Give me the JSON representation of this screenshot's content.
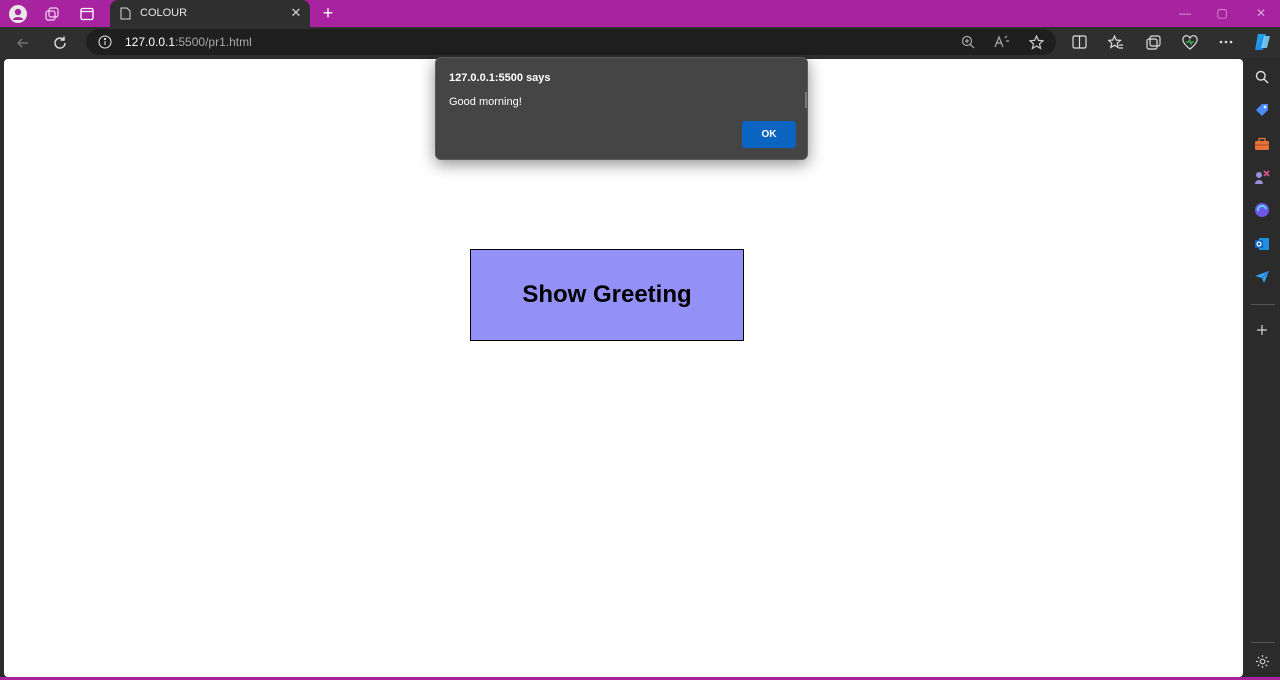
{
  "browser": {
    "tab_title": "COLOUR",
    "tab_close": "✕",
    "new_tab": "+",
    "url_host": "127.0.0.1",
    "url_path": ":5500/pr1.html",
    "window_controls": {
      "minimize": "—",
      "maximize": "▢",
      "close": "✕"
    },
    "accent_color": "#a8239f"
  },
  "page": {
    "button_label": "Show Greeting",
    "button_color": "#9391f6"
  },
  "dialog": {
    "title": "127.0.0.1:5500 says",
    "message": "Good morning!",
    "ok_label": "OK"
  },
  "sidebar": {
    "icons": [
      "search-icon",
      "shopping-tag-icon",
      "briefcase-icon",
      "games-icon",
      "copilot-icon",
      "outlook-icon",
      "send-icon",
      "add-icon",
      "settings-icon"
    ]
  }
}
